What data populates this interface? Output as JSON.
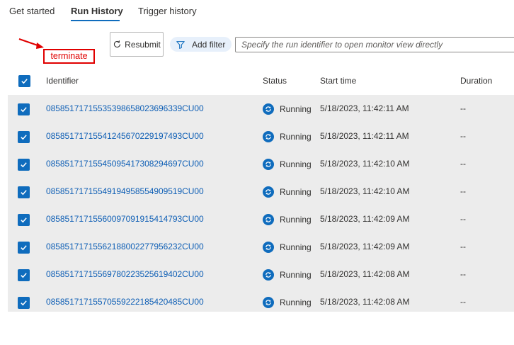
{
  "tabs": [
    {
      "label": "Get started"
    },
    {
      "label": "Run History"
    },
    {
      "label": "Trigger history"
    }
  ],
  "active_tab": "Run History",
  "annotation": {
    "label": "terminate",
    "color": "#e00000"
  },
  "toolbar": {
    "resubmit_label": "Resubmit",
    "add_filter_label": "Add filter",
    "search_placeholder": "Specify the run identifier to open monitor view directly"
  },
  "table": {
    "columns": {
      "identifier": "Identifier",
      "status": "Status",
      "start_time": "Start time",
      "duration": "Duration"
    },
    "select_all_checked": true,
    "rows": [
      {
        "id": "08585171715535398658023696339CU00",
        "status": "Running",
        "start_time": "5/18/2023, 11:42:11 AM",
        "duration": "--",
        "checked": true
      },
      {
        "id": "08585171715541245670229197493CU00",
        "status": "Running",
        "start_time": "5/18/2023, 11:42:11 AM",
        "duration": "--",
        "checked": true
      },
      {
        "id": "08585171715545095417308294697CU00",
        "status": "Running",
        "start_time": "5/18/2023, 11:42:10 AM",
        "duration": "--",
        "checked": true
      },
      {
        "id": "08585171715549194958554909519CU00",
        "status": "Running",
        "start_time": "5/18/2023, 11:42:10 AM",
        "duration": "--",
        "checked": true
      },
      {
        "id": "08585171715560097091915414793CU00",
        "status": "Running",
        "start_time": "5/18/2023, 11:42:09 AM",
        "duration": "--",
        "checked": true
      },
      {
        "id": "08585171715562188002277956232CU00",
        "status": "Running",
        "start_time": "5/18/2023, 11:42:09 AM",
        "duration": "--",
        "checked": true
      },
      {
        "id": "08585171715569780223525619402CU00",
        "status": "Running",
        "start_time": "5/18/2023, 11:42:08 AM",
        "duration": "--",
        "checked": true
      },
      {
        "id": "08585171715570559222185420485CU00",
        "status": "Running",
        "start_time": "5/18/2023, 11:42:08 AM",
        "duration": "--",
        "checked": true
      }
    ]
  },
  "colors": {
    "accent": "#0f6cbd",
    "link": "#0f5fb5",
    "selected_row_bg": "#ececec",
    "filter_bg": "#e7f0fb"
  },
  "icons": {
    "resubmit": "refresh-icon",
    "filter": "funnel-icon",
    "status": "running-sync-icon",
    "checkbox": "checkmark-icon"
  }
}
